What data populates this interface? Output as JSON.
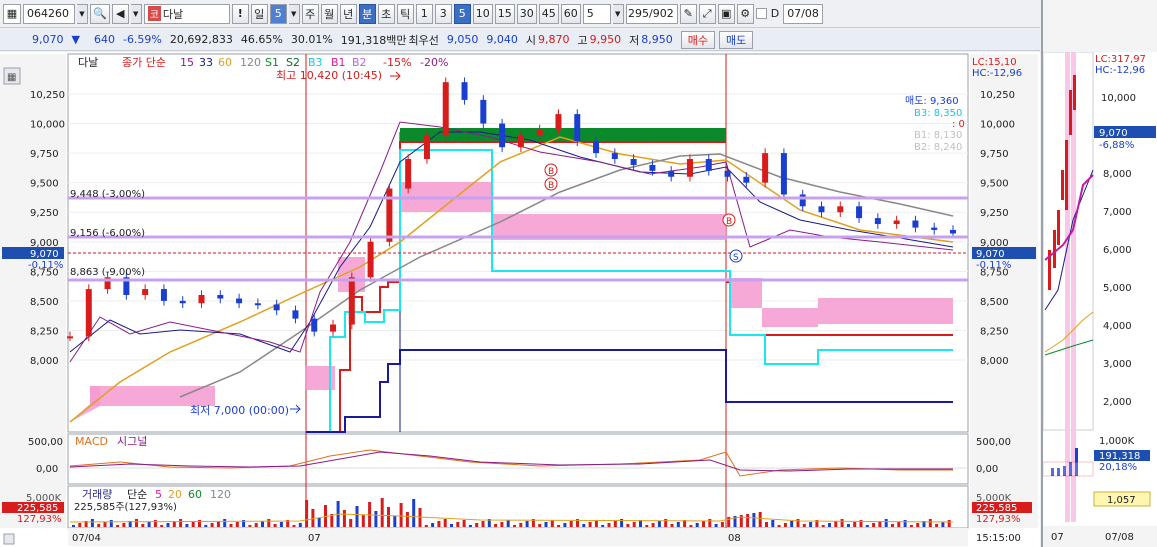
{
  "toolbar": {
    "code": "064260",
    "name": "다날",
    "tag": "코",
    "period_num": "5",
    "periods": [
      "일",
      "주",
      "월",
      "년",
      "분",
      "초",
      "틱"
    ],
    "intervals": [
      "1",
      "3",
      "5",
      "10",
      "15",
      "30",
      "45",
      "60"
    ],
    "count_value": "5",
    "page_counter": "295/902",
    "d_label": "D",
    "date_value": "07/08"
  },
  "quote": {
    "price": "9,070",
    "change": "640",
    "change_pct": "-6.59%",
    "volume": "20,692,833",
    "ratio1": "46.65%",
    "ratio2": "30.01%",
    "amount": "191,318백만",
    "bid_label": "최우선",
    "bid1": "9,050",
    "bid2": "9,040",
    "open_label": "시",
    "open": "9,870",
    "high_label": "고",
    "high": "9,950",
    "low_label": "저",
    "low": "8,950",
    "buy_label": "매수",
    "sell_label": "매도"
  },
  "main_legend": {
    "name": "다날",
    "close_ma": "종가 단순",
    "ma_values": [
      "15",
      "33",
      "60",
      "120"
    ],
    "s_lines": [
      "S1",
      "S2"
    ],
    "b_lines": [
      "B3",
      "B1",
      "B2"
    ],
    "pct_lines": [
      "-15%",
      "-20%"
    ]
  },
  "annotations": {
    "high": "최고 10,420 (10:45)",
    "low": "최저 7,000 (00:00)",
    "lc": "LC:15,10",
    "hc": "HC:-12,96",
    "ask": "매도: 9,360",
    "b3": "B3: 8,350",
    "zero": ": 0",
    "b1": "B1: 8,130",
    "b2": "B2: 8,240",
    "line_3": "9,448 (-3,00%)",
    "line_6": "9,156 (-6,00%)",
    "line_9": "8,863 (-9,00%)",
    "price_tag": "9,070",
    "price_pct": "-0,11%",
    "price_tag_r": "9,070",
    "price_pct_r": "-0,11%",
    "b_marker": "B",
    "s_marker": "S"
  },
  "y_axis_ticks": [
    "10,250",
    "10,000",
    "9,750",
    "9,500",
    "9,250",
    "9,000",
    "8,750",
    "8,500",
    "8,250",
    "8,000"
  ],
  "macd": {
    "label": "MACD",
    "signal_label": "시그널",
    "ticks": [
      "500,00",
      "0,00"
    ]
  },
  "volume": {
    "label": "거래량",
    "ma_label": "단순",
    "mas": [
      "5",
      "20",
      "60",
      "120"
    ],
    "summary": "225,585주(127,93%)",
    "tag": "225,585",
    "tag_pct": "127,93%",
    "tick": "5,000K",
    "tag_r": "225,585",
    "tag_pct_r": "127,93%",
    "tick_r": "5,000K"
  },
  "x_axis": {
    "labels": [
      "07/04",
      "07",
      "08"
    ],
    "time": "15:15:00"
  },
  "side_panel": {
    "lc": "LC:317,97",
    "hc": "HC:-12,96",
    "ticks": [
      "10,000",
      "9,000",
      "8,000",
      "7,000",
      "6,000",
      "5,000",
      "4,000",
      "3,000",
      "2,000"
    ],
    "price_tag": "9,070",
    "price_pct": "-6,88%",
    "vol_ticks": [
      "1,000K"
    ],
    "vol_tag": "191,318",
    "vol_pct": "20,18%",
    "extra_tag": "1,057",
    "x_labels": [
      "07",
      "07/08"
    ]
  },
  "colors": {
    "up": "#d81b1b",
    "down": "#1a3fd0",
    "ma15": "#8a1c8a",
    "ma33": "#1a1a8a",
    "ma60": "#e0a020",
    "ma120": "#888888",
    "pink_cloud": "#f59ad0",
    "band_line": "#c8a0f0",
    "green_box": "#0a8a2a",
    "cyan": "#19e8f0"
  }
}
